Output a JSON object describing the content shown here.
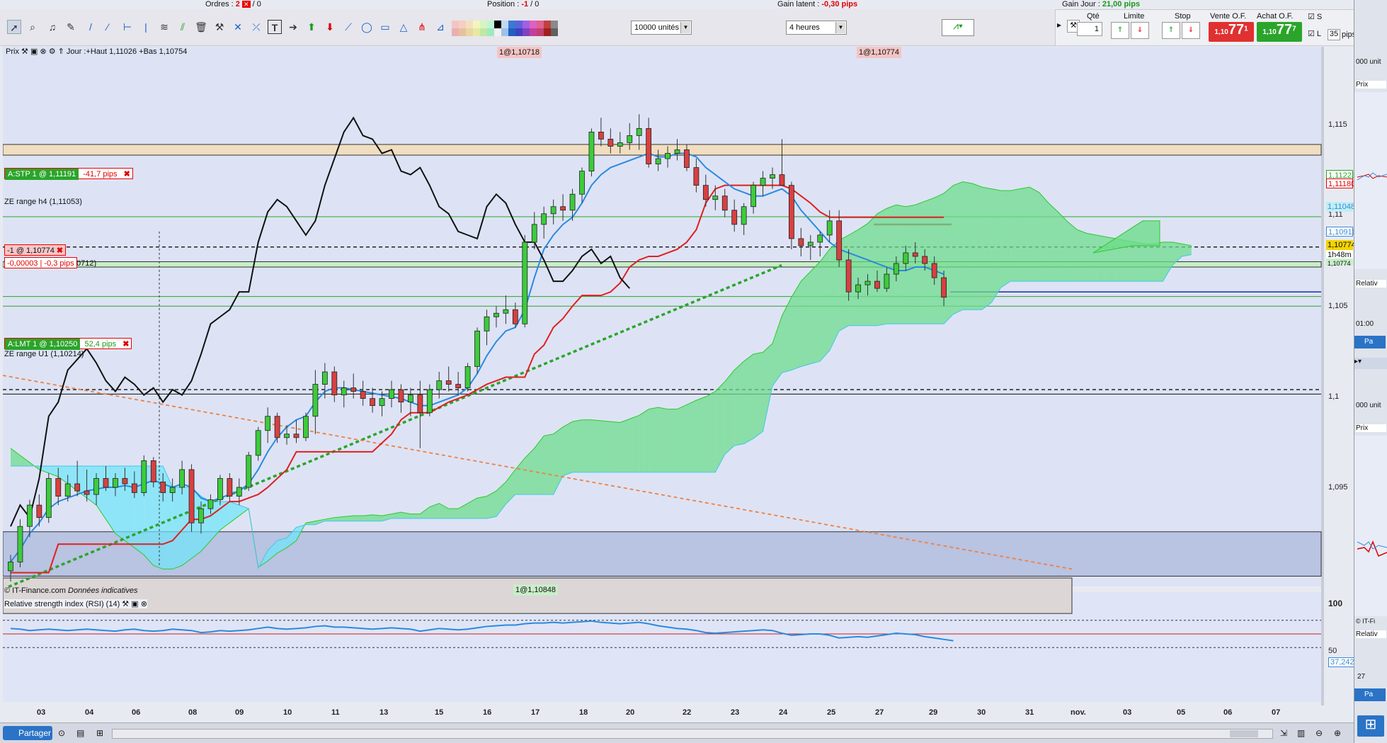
{
  "status_bar": {
    "orders_label": "Ordres :",
    "orders_red": "2",
    "orders_sep": "/",
    "orders_val": "0",
    "position_label": "Position :",
    "position_red": "-1",
    "position_sep": "/",
    "position_val": "0",
    "gain_latent_label": "Gain latent :",
    "gain_latent_val": "-0,30 pips",
    "gain_jour_label": "Gain Jour :",
    "gain_jour_val": "21,00 pips"
  },
  "toolbar": {
    "units_select": "10000 unités",
    "period_select": "4 heures"
  },
  "order_panel": {
    "qty_label": "Qté",
    "qty_value": "1",
    "limit_label": "Limite",
    "stop_label": "Stop",
    "sell_label": "Vente O.F.",
    "sell_price_small": "1,10",
    "sell_price_big": "77",
    "sell_price_sup": "1",
    "buy_label": "Achat O.F.",
    "buy_price_small": "1,10",
    "buy_price_big": "77",
    "buy_price_sup": "7",
    "s_label": "S",
    "l_label": "L",
    "pips_value": "35",
    "pips_label": "pips"
  },
  "chart_header": {
    "prix_label": "Prix",
    "info": "Jour :+Haut 1,11026 +Bas 1,10754",
    "top_tag1": "1@1,10718",
    "top_tag2": "1@1,10774",
    "bottom_tag": "1@1,10848",
    "copyright": "© IT-Finance.com",
    "copyright_italic": "Données indicatives"
  },
  "orders": {
    "stp_label": "A:STP  1 @ 1,11191",
    "stp_pips": "-41,7 pips",
    "pos_label": "-1 @ 1,10774",
    "pos_pl": "-0,00003",
    "pos_pips": "-0,3 pips",
    "pos_extra": "0712)",
    "lmt_label": "A:LMT  1 @ 1,10250",
    "lmt_pips": "52,4 pips",
    "ze_h4": "ZE range h4 (1,11053)",
    "ze_u1": "ZE range U1 (1,10214)"
  },
  "price_boxes": {
    "p1": "1,11223",
    "p2": "1,11180",
    "p3": "1,11048",
    "p4": "1,10911",
    "p5": "1,10774",
    "p6": "1h48m",
    "p7": "1,10774"
  },
  "rsi": {
    "title": "Relative strength index (RSI) (14)",
    "level_100": "100",
    "level_50": "50",
    "value": "37,242"
  },
  "right_panel": {
    "t1": "000 unit",
    "t2": "Prix",
    "t3": "Relativ",
    "t4": "01:00",
    "t5": "000 unit",
    "t6": "Prix",
    "t7": "© IT-Fi",
    "t8": "Relativ",
    "t9": "27",
    "t10": "Pa",
    "t11": "Pa"
  },
  "bottom_bar": {
    "share_label": "Partager"
  },
  "chart_data": {
    "type": "candlestick",
    "y_tick_labels": [
      "1,115",
      "1,11",
      "1,105",
      "1,1",
      "1,095"
    ],
    "y_tick_values": [
      1.115,
      1.11,
      1.105,
      1.1,
      1.095
    ],
    "ylim": [
      1.0915,
      1.1218
    ],
    "x_tick_labels": [
      "03",
      "04",
      "06",
      "08",
      "09",
      "10",
      "11",
      "13",
      "15",
      "16",
      "17",
      "18",
      "20",
      "22",
      "23",
      "24",
      "25",
      "27",
      "29",
      "30",
      "31",
      "nov.",
      "03",
      "05",
      "06",
      "07"
    ],
    "rsi_ylim": [
      0,
      100
    ],
    "rsi_levels": [
      70,
      50,
      30
    ],
    "candles": [
      [
        1.0923,
        1.0932,
        1.0917,
        1.0928
      ],
      [
        1.0928,
        1.0952,
        1.0925,
        1.0948
      ],
      [
        1.0948,
        1.0963,
        1.0942,
        1.096
      ],
      [
        1.096,
        1.0966,
        1.0948,
        1.0953
      ],
      [
        1.0953,
        1.0978,
        1.095,
        1.0975
      ],
      [
        1.0975,
        1.0981,
        1.096,
        1.0965
      ],
      [
        1.0965,
        1.0977,
        1.0962,
        1.0972
      ],
      [
        1.0972,
        1.0985,
        1.0965,
        1.0968
      ],
      [
        1.0968,
        1.098,
        1.0962,
        1.0966
      ],
      [
        1.0966,
        1.0978,
        1.096,
        1.0975
      ],
      [
        1.0975,
        1.0982,
        1.0968,
        1.097
      ],
      [
        1.097,
        1.0978,
        1.0965,
        1.0975
      ],
      [
        1.0975,
        1.0981,
        1.0968,
        1.0972
      ],
      [
        1.0972,
        1.0979,
        1.0964,
        1.0967
      ],
      [
        1.0967,
        1.0988,
        1.0965,
        1.0985
      ],
      [
        1.0985,
        1.0987,
        1.097,
        1.0973
      ],
      [
        1.0973,
        1.0978,
        1.0962,
        1.0967
      ],
      [
        1.0967,
        1.0975,
        1.0962,
        1.097
      ],
      [
        1.097,
        1.0985,
        1.0966,
        1.098
      ],
      [
        1.098,
        1.0983,
        1.0945,
        1.095
      ],
      [
        1.095,
        1.0962,
        1.0944,
        1.0958
      ],
      [
        1.0958,
        1.0966,
        1.0955,
        1.0963
      ],
      [
        1.0963,
        1.0977,
        1.096,
        1.0975
      ],
      [
        1.0975,
        1.0978,
        1.0962,
        1.0965
      ],
      [
        1.0965,
        1.0975,
        1.096,
        1.097
      ],
      [
        1.097,
        1.099,
        1.0968,
        1.0988
      ],
      [
        1.0988,
        1.1004,
        1.0985,
        1.1002
      ],
      [
        1.1002,
        1.1015,
        1.0995,
        1.101
      ],
      [
        1.101,
        1.1012,
        1.0995,
        1.0998
      ],
      [
        1.0998,
        1.1005,
        1.0994,
        1.1
      ],
      [
        1.1,
        1.1008,
        1.0995,
        1.0998
      ],
      [
        1.0998,
        1.1012,
        1.0996,
        1.101
      ],
      [
        1.101,
        1.1036,
        1.1,
        1.1028
      ],
      [
        1.1028,
        1.104,
        1.102,
        1.1035
      ],
      [
        1.1035,
        1.1038,
        1.1018,
        1.1022
      ],
      [
        1.1022,
        1.103,
        1.1015,
        1.1026
      ],
      [
        1.1026,
        1.1034,
        1.102,
        1.1024
      ],
      [
        1.1024,
        1.103,
        1.1016,
        1.102
      ],
      [
        1.102,
        1.1026,
        1.1012,
        1.1016
      ],
      [
        1.1016,
        1.1024,
        1.101,
        1.102
      ],
      [
        1.102,
        1.103,
        1.1015,
        1.1025
      ],
      [
        1.1025,
        1.1028,
        1.1012,
        1.1018
      ],
      [
        1.1018,
        1.1026,
        1.101,
        1.1022
      ],
      [
        1.1022,
        1.103,
        1.0992,
        1.1012
      ],
      [
        1.1012,
        1.1028,
        1.101,
        1.1025
      ],
      [
        1.1025,
        1.1035,
        1.102,
        1.103
      ],
      [
        1.103,
        1.1038,
        1.1024,
        1.1028
      ],
      [
        1.1028,
        1.1035,
        1.1022,
        1.1026
      ],
      [
        1.1026,
        1.104,
        1.1024,
        1.1038
      ],
      [
        1.1038,
        1.106,
        1.1034,
        1.1058
      ],
      [
        1.1058,
        1.107,
        1.105,
        1.1066
      ],
      [
        1.1066,
        1.1072,
        1.106,
        1.1068
      ],
      [
        1.1068,
        1.1078,
        1.1062,
        1.107
      ],
      [
        1.107,
        1.1074,
        1.106,
        1.1062
      ],
      [
        1.1062,
        1.1112,
        1.106,
        1.1108
      ],
      [
        1.1108,
        1.1125,
        1.1104,
        1.1118
      ],
      [
        1.1118,
        1.1128,
        1.111,
        1.1124
      ],
      [
        1.1124,
        1.1132,
        1.1118,
        1.1128
      ],
      [
        1.1128,
        1.1135,
        1.112,
        1.1126
      ],
      [
        1.1126,
        1.1138,
        1.112,
        1.1135
      ],
      [
        1.1135,
        1.115,
        1.113,
        1.1148
      ],
      [
        1.1148,
        1.1172,
        1.1145,
        1.117
      ],
      [
        1.117,
        1.1178,
        1.1162,
        1.1166
      ],
      [
        1.1166,
        1.1172,
        1.1158,
        1.1162
      ],
      [
        1.1162,
        1.117,
        1.1158,
        1.1164
      ],
      [
        1.1164,
        1.1175,
        1.116,
        1.1168
      ],
      [
        1.1168,
        1.118,
        1.116,
        1.1172
      ],
      [
        1.1172,
        1.1178,
        1.115,
        1.1152
      ],
      [
        1.1152,
        1.116,
        1.1148,
        1.1155
      ],
      [
        1.1155,
        1.1162,
        1.115,
        1.1158
      ],
      [
        1.1158,
        1.1166,
        1.1154,
        1.116
      ],
      [
        1.116,
        1.1163,
        1.1148,
        1.115
      ],
      [
        1.115,
        1.1155,
        1.1136,
        1.114
      ],
      [
        1.114,
        1.1146,
        1.1128,
        1.1132
      ],
      [
        1.1132,
        1.114,
        1.1126,
        1.1134
      ],
      [
        1.1134,
        1.1138,
        1.1122,
        1.1126
      ],
      [
        1.1126,
        1.1132,
        1.1114,
        1.1118
      ],
      [
        1.1118,
        1.113,
        1.1112,
        1.1128
      ],
      [
        1.1128,
        1.1142,
        1.1124,
        1.114
      ],
      [
        1.114,
        1.1148,
        1.1134,
        1.1144
      ],
      [
        1.1144,
        1.115,
        1.1138,
        1.1146
      ],
      [
        1.1146,
        1.1166,
        1.114,
        1.114
      ],
      [
        1.114,
        1.1142,
        1.1104,
        1.111
      ],
      [
        1.111,
        1.1116,
        1.11,
        1.1106
      ],
      [
        1.1106,
        1.1112,
        1.1098,
        1.1108
      ],
      [
        1.1108,
        1.1114,
        1.11,
        1.1112
      ],
      [
        1.1112,
        1.1126,
        1.1108,
        1.112
      ],
      [
        1.112,
        1.1126,
        1.1094,
        1.1098
      ],
      [
        1.1098,
        1.1104,
        1.1075,
        1.108
      ],
      [
        1.108,
        1.1088,
        1.1076,
        1.1084
      ],
      [
        1.1084,
        1.109,
        1.1078,
        1.1086
      ],
      [
        1.1086,
        1.1092,
        1.108,
        1.1082
      ],
      [
        1.1082,
        1.1094,
        1.108,
        1.109
      ],
      [
        1.109,
        1.11,
        1.1086,
        1.1096
      ],
      [
        1.1096,
        1.1106,
        1.1092,
        1.1102
      ],
      [
        1.1102,
        1.1108,
        1.1096,
        1.11
      ],
      [
        1.11,
        1.1104,
        1.1092,
        1.1096
      ],
      [
        1.1096,
        1.11,
        1.1084,
        1.1088
      ],
      [
        1.1088,
        1.1092,
        1.1072,
        1.1077
      ]
    ],
    "tenkan": [
      1.0928,
      1.0935,
      1.0944,
      1.095,
      1.0958,
      1.0962,
      1.0964,
      1.0966,
      1.0968,
      1.0969,
      1.097,
      1.097,
      1.0971,
      1.097,
      1.0972,
      1.0974,
      1.0972,
      1.097,
      1.0972,
      1.097,
      1.0964,
      1.0962,
      1.0964,
      1.0966,
      1.0968,
      1.0972,
      1.098,
      1.099,
      1.0998,
      1.1004,
      1.1008,
      1.101,
      1.1018,
      1.1024,
      1.1026,
      1.1026,
      1.1025,
      1.1024,
      1.1023,
      1.1022,
      1.1021,
      1.102,
      1.1018,
      1.1016,
      1.1016,
      1.1018,
      1.102,
      1.1022,
      1.1026,
      1.1034,
      1.1044,
      1.1052,
      1.1058,
      1.106,
      1.107,
      1.1088,
      1.1104,
      1.1112,
      1.1118,
      1.1122,
      1.113,
      1.114,
      1.1146,
      1.115,
      1.1152,
      1.1154,
      1.1156,
      1.1158,
      1.1156,
      1.1156,
      1.1158,
      1.1158,
      1.1156,
      1.115,
      1.1146,
      1.1142,
      1.1138,
      1.1136,
      1.1134,
      1.1134,
      1.1136,
      1.1138,
      1.1134,
      1.1126,
      1.112,
      1.1114,
      1.1108,
      1.1104,
      1.1102,
      1.11,
      1.1098,
      1.1096,
      1.1094,
      1.1092,
      1.1092,
      1.1094,
      1.1094,
      1.1092,
      1.109
    ],
    "kijun": [
      1.0922,
      1.0922,
      1.0922,
      1.0922,
      1.0922,
      1.0938,
      1.0938,
      1.0938,
      1.0938,
      1.0938,
      1.0938,
      1.0938,
      1.0938,
      1.0938,
      1.0938,
      1.0938,
      1.0938,
      1.094,
      1.0946,
      1.0952,
      1.0952,
      1.0954,
      1.0958,
      1.0962,
      1.0962,
      1.0964,
      1.0966,
      1.097,
      1.0975,
      1.098,
      1.099,
      1.099,
      1.099,
      1.099,
      1.099,
      1.099,
      1.099,
      1.099,
      1.099,
      1.0995,
      1.1,
      1.1008,
      1.1012,
      1.1012,
      1.1012,
      1.1015,
      1.1018,
      1.102,
      1.1022,
      1.1025,
      1.1028,
      1.103,
      1.1032,
      1.1032,
      1.1032,
      1.1045,
      1.105,
      1.106,
      1.1065,
      1.1072,
      1.1078,
      1.1078,
      1.1078,
      1.108,
      1.1085,
      1.1094,
      1.1098,
      1.11,
      1.11,
      1.1102,
      1.1104,
      1.1108,
      1.1115,
      1.113,
      1.1138,
      1.114,
      1.114,
      1.114,
      1.114,
      1.114,
      1.114,
      1.114,
      1.1138,
      1.1134,
      1.113,
      1.1125,
      1.1122,
      1.1122,
      1.1122,
      1.1122,
      1.1122,
      1.1122,
      1.1122,
      1.1122,
      1.1122,
      1.1122,
      1.1122,
      1.1122,
      1.1122
    ],
    "chikou": [
      1.0948,
      1.096,
      1.0953,
      1.0975,
      1.101,
      1.1018,
      1.1036,
      1.1042,
      1.1048,
      1.104,
      1.103,
      1.1024,
      1.1032,
      1.1028,
      1.1022,
      1.1026,
      1.1018,
      1.1025,
      1.1022,
      1.103,
      1.1045,
      1.1062,
      1.1066,
      1.107,
      1.108,
      1.108,
      1.1108,
      1.1125,
      1.1132,
      1.1128,
      1.112,
      1.1112,
      1.112,
      1.114,
      1.1155,
      1.117,
      1.1178,
      1.1168,
      1.1166,
      1.1158,
      1.116,
      1.1148,
      1.1146,
      1.115,
      1.114,
      1.1128,
      1.1124,
      1.1114,
      1.1112,
      1.111,
      1.1128,
      1.1135,
      1.113,
      1.1118,
      1.1108,
      1.1108,
      1.1098,
      1.1086,
      1.1086,
      1.1092,
      1.11,
      1.1104,
      1.1096,
      1.11,
      1.1088,
      1.1082
    ],
    "rsi_values": [
      58,
      57,
      55,
      56,
      57,
      56,
      55,
      56,
      57,
      56,
      55,
      54,
      56,
      57,
      55,
      54,
      55,
      57,
      56,
      55,
      52,
      53,
      55,
      54,
      55,
      56,
      58,
      60,
      58,
      57,
      58,
      59,
      61,
      62,
      60,
      60,
      59,
      58,
      57,
      58,
      59,
      58,
      57,
      54,
      56,
      58,
      57,
      56,
      57,
      59,
      61,
      62,
      63,
      63,
      65,
      66,
      66,
      67,
      66,
      67,
      68,
      69,
      67,
      66,
      65,
      66,
      67,
      65,
      62,
      60,
      58,
      57,
      55,
      52,
      51,
      52,
      53,
      54,
      55,
      56,
      55,
      51,
      48,
      49,
      50,
      50,
      48,
      44,
      45,
      46,
      45,
      47,
      49,
      51,
      50,
      49,
      46,
      44,
      42,
      40
    ]
  }
}
